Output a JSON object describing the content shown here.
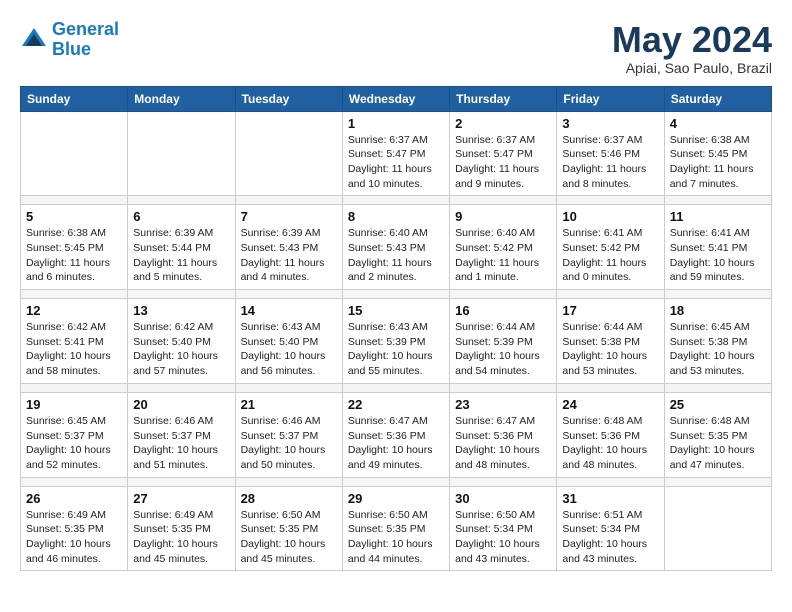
{
  "header": {
    "logo_line1": "General",
    "logo_line2": "Blue",
    "month": "May 2024",
    "location": "Apiai, Sao Paulo, Brazil"
  },
  "weekdays": [
    "Sunday",
    "Monday",
    "Tuesday",
    "Wednesday",
    "Thursday",
    "Friday",
    "Saturday"
  ],
  "weeks": [
    [
      {
        "day": "",
        "info": ""
      },
      {
        "day": "",
        "info": ""
      },
      {
        "day": "",
        "info": ""
      },
      {
        "day": "1",
        "info": "Sunrise: 6:37 AM\nSunset: 5:47 PM\nDaylight: 11 hours and 10 minutes."
      },
      {
        "day": "2",
        "info": "Sunrise: 6:37 AM\nSunset: 5:47 PM\nDaylight: 11 hours and 9 minutes."
      },
      {
        "day": "3",
        "info": "Sunrise: 6:37 AM\nSunset: 5:46 PM\nDaylight: 11 hours and 8 minutes."
      },
      {
        "day": "4",
        "info": "Sunrise: 6:38 AM\nSunset: 5:45 PM\nDaylight: 11 hours and 7 minutes."
      }
    ],
    [
      {
        "day": "5",
        "info": "Sunrise: 6:38 AM\nSunset: 5:45 PM\nDaylight: 11 hours and 6 minutes."
      },
      {
        "day": "6",
        "info": "Sunrise: 6:39 AM\nSunset: 5:44 PM\nDaylight: 11 hours and 5 minutes."
      },
      {
        "day": "7",
        "info": "Sunrise: 6:39 AM\nSunset: 5:43 PM\nDaylight: 11 hours and 4 minutes."
      },
      {
        "day": "8",
        "info": "Sunrise: 6:40 AM\nSunset: 5:43 PM\nDaylight: 11 hours and 2 minutes."
      },
      {
        "day": "9",
        "info": "Sunrise: 6:40 AM\nSunset: 5:42 PM\nDaylight: 11 hours and 1 minute."
      },
      {
        "day": "10",
        "info": "Sunrise: 6:41 AM\nSunset: 5:42 PM\nDaylight: 11 hours and 0 minutes."
      },
      {
        "day": "11",
        "info": "Sunrise: 6:41 AM\nSunset: 5:41 PM\nDaylight: 10 hours and 59 minutes."
      }
    ],
    [
      {
        "day": "12",
        "info": "Sunrise: 6:42 AM\nSunset: 5:41 PM\nDaylight: 10 hours and 58 minutes."
      },
      {
        "day": "13",
        "info": "Sunrise: 6:42 AM\nSunset: 5:40 PM\nDaylight: 10 hours and 57 minutes."
      },
      {
        "day": "14",
        "info": "Sunrise: 6:43 AM\nSunset: 5:40 PM\nDaylight: 10 hours and 56 minutes."
      },
      {
        "day": "15",
        "info": "Sunrise: 6:43 AM\nSunset: 5:39 PM\nDaylight: 10 hours and 55 minutes."
      },
      {
        "day": "16",
        "info": "Sunrise: 6:44 AM\nSunset: 5:39 PM\nDaylight: 10 hours and 54 minutes."
      },
      {
        "day": "17",
        "info": "Sunrise: 6:44 AM\nSunset: 5:38 PM\nDaylight: 10 hours and 53 minutes."
      },
      {
        "day": "18",
        "info": "Sunrise: 6:45 AM\nSunset: 5:38 PM\nDaylight: 10 hours and 53 minutes."
      }
    ],
    [
      {
        "day": "19",
        "info": "Sunrise: 6:45 AM\nSunset: 5:37 PM\nDaylight: 10 hours and 52 minutes."
      },
      {
        "day": "20",
        "info": "Sunrise: 6:46 AM\nSunset: 5:37 PM\nDaylight: 10 hours and 51 minutes."
      },
      {
        "day": "21",
        "info": "Sunrise: 6:46 AM\nSunset: 5:37 PM\nDaylight: 10 hours and 50 minutes."
      },
      {
        "day": "22",
        "info": "Sunrise: 6:47 AM\nSunset: 5:36 PM\nDaylight: 10 hours and 49 minutes."
      },
      {
        "day": "23",
        "info": "Sunrise: 6:47 AM\nSunset: 5:36 PM\nDaylight: 10 hours and 48 minutes."
      },
      {
        "day": "24",
        "info": "Sunrise: 6:48 AM\nSunset: 5:36 PM\nDaylight: 10 hours and 48 minutes."
      },
      {
        "day": "25",
        "info": "Sunrise: 6:48 AM\nSunset: 5:35 PM\nDaylight: 10 hours and 47 minutes."
      }
    ],
    [
      {
        "day": "26",
        "info": "Sunrise: 6:49 AM\nSunset: 5:35 PM\nDaylight: 10 hours and 46 minutes."
      },
      {
        "day": "27",
        "info": "Sunrise: 6:49 AM\nSunset: 5:35 PM\nDaylight: 10 hours and 45 minutes."
      },
      {
        "day": "28",
        "info": "Sunrise: 6:50 AM\nSunset: 5:35 PM\nDaylight: 10 hours and 45 minutes."
      },
      {
        "day": "29",
        "info": "Sunrise: 6:50 AM\nSunset: 5:35 PM\nDaylight: 10 hours and 44 minutes."
      },
      {
        "day": "30",
        "info": "Sunrise: 6:50 AM\nSunset: 5:34 PM\nDaylight: 10 hours and 43 minutes."
      },
      {
        "day": "31",
        "info": "Sunrise: 6:51 AM\nSunset: 5:34 PM\nDaylight: 10 hours and 43 minutes."
      },
      {
        "day": "",
        "info": ""
      }
    ]
  ]
}
